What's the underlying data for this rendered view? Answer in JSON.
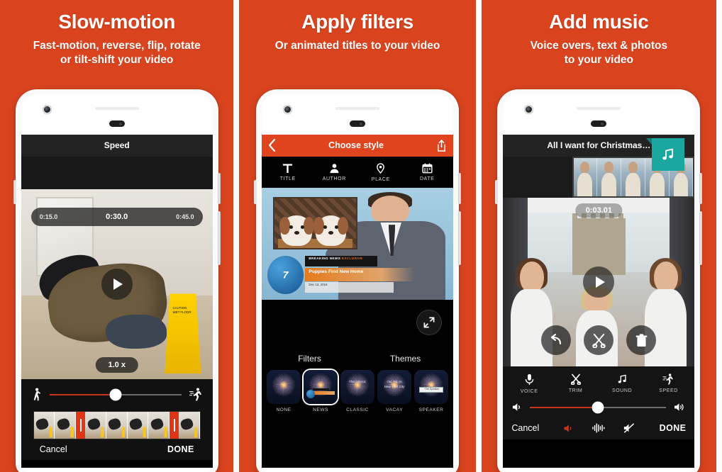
{
  "theme": {
    "brand_orange": "#d9441f",
    "accent_red": "#c7351c",
    "teal": "#1aa7a0",
    "dark": "#141414"
  },
  "panels": [
    {
      "title": "Slow-motion",
      "subtitle_line1": "Fast-motion, reverse, flip, rotate",
      "subtitle_line2": "or tilt-shift your video",
      "screen": {
        "header_title": "Speed",
        "time_left": "0:15.0",
        "time_center": "0:30.0",
        "time_right": "0:45.0",
        "speed_badge": "1.0 x",
        "slider_left_icon": "walk-icon",
        "slider_right_icon": "run-icon",
        "play_icon": "play-icon",
        "cone_text": "CAUTION WET FLOOR",
        "cancel_label": "Cancel",
        "done_label": "DONE"
      }
    },
    {
      "title": "Apply filters",
      "subtitle_line1": "Or animated titles to your video",
      "subtitle_line2": "",
      "screen": {
        "header_title": "Choose style",
        "back_icon": "chevron-left-icon",
        "share_icon": "share-icon",
        "tabs": [
          {
            "label": "TITLE",
            "icon": "text-t-icon"
          },
          {
            "label": "AUTHOR",
            "icon": "person-icon"
          },
          {
            "label": "PLACE",
            "icon": "location-pin-icon"
          },
          {
            "label": "DATE",
            "icon": "calendar-icon"
          }
        ],
        "news_overlay": {
          "breaking_label": "BREAKING NEWS",
          "breaking_sub": "EXCLUSIVE",
          "headline": "Puppies Find New Home",
          "date": "Dec 13, 2016",
          "channel_number": "7"
        },
        "expand_icon": "expand-icon",
        "sections": [
          "Filters",
          "Themes"
        ],
        "thumbs": [
          {
            "label": "NONE",
            "selected": false
          },
          {
            "label": "NEWS",
            "selected": true
          },
          {
            "label": "CLASSIC",
            "selected": false
          },
          {
            "label": "VACAY",
            "selected": false
          },
          {
            "label": "SPEAKER",
            "selected": false
          }
        ],
        "thumb_overlays": {
          "classic": "The Classic",
          "vacay_line1": "Our Trip to",
          "vacay_line2": "New York City",
          "speaker": "The Speaker"
        }
      }
    },
    {
      "title": "Add music",
      "subtitle_line1": "Voice overs, text & photos",
      "subtitle_line2": "to your video",
      "screen": {
        "header_title": "All I want for Christmas…",
        "timestamp": "0:03.01",
        "music_badge_icon": "music-note-icon",
        "play_icon": "play-icon",
        "round_buttons": [
          {
            "icon": "undo-icon"
          },
          {
            "icon": "scissors-icon"
          },
          {
            "icon": "trash-icon"
          }
        ],
        "tools": [
          {
            "label": "VOICE",
            "icon": "microphone-icon"
          },
          {
            "label": "TRIM",
            "icon": "scissors-icon"
          },
          {
            "label": "SOUND",
            "icon": "music-note-icon"
          },
          {
            "label": "SPEED",
            "icon": "run-icon"
          }
        ],
        "volume_left_icon": "volume-low-icon",
        "volume_right_icon": "volume-high-icon",
        "cancel_label": "Cancel",
        "done_label": "DONE",
        "footer_icons": [
          {
            "icon": "speaker-active-icon",
            "active": true
          },
          {
            "icon": "waveform-icon",
            "active": false
          },
          {
            "icon": "volume-mute-icon",
            "active": false
          }
        ]
      }
    }
  ]
}
